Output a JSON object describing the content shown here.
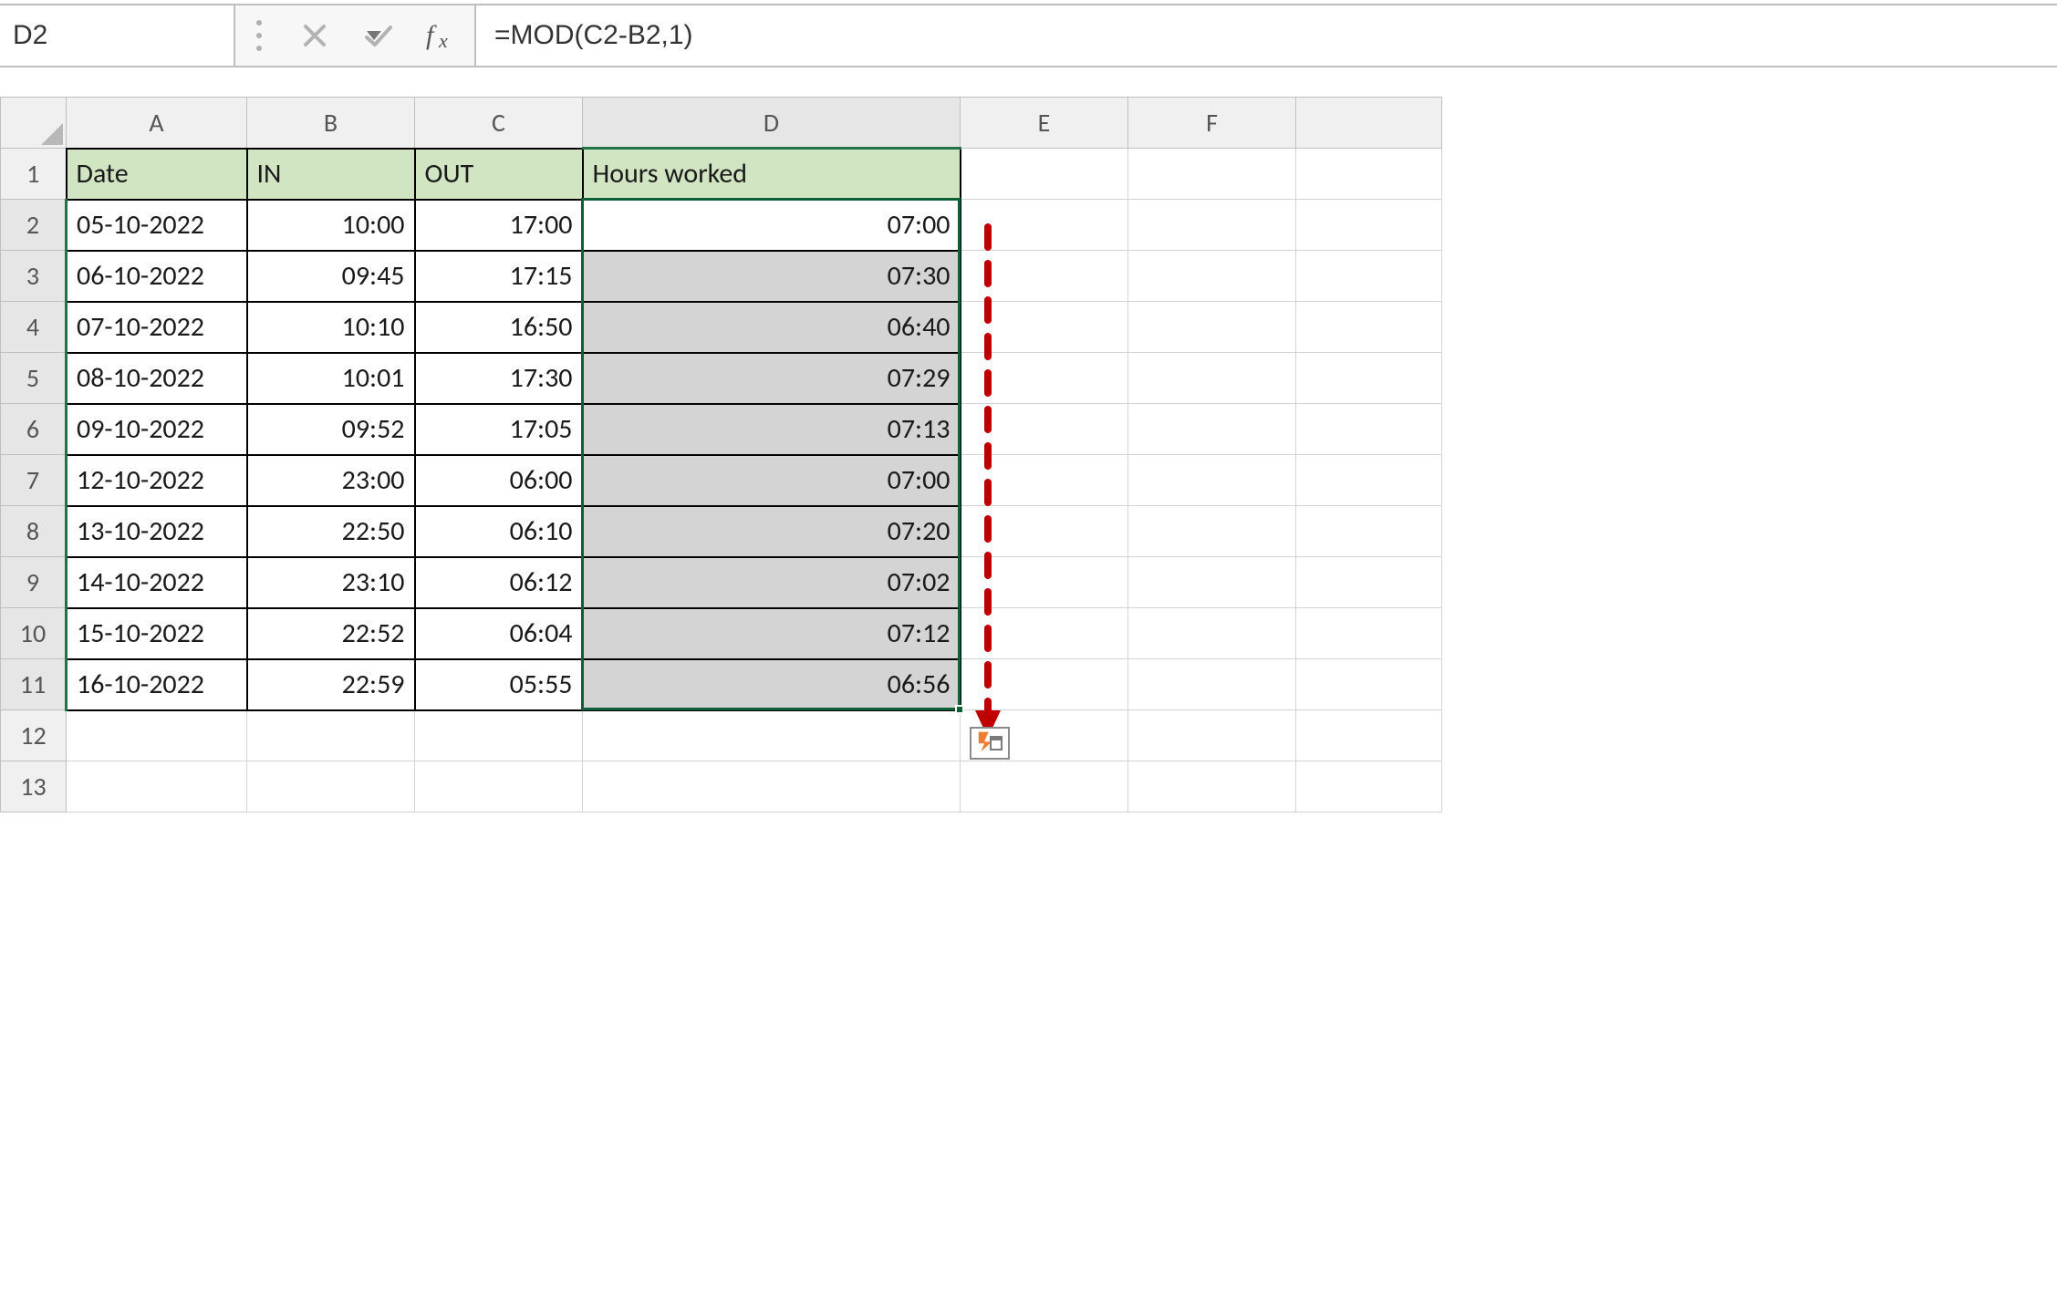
{
  "formula_bar": {
    "cell_ref": "D2",
    "formula": "=MOD(C2-B2,1)"
  },
  "columns": [
    "A",
    "B",
    "C",
    "D",
    "E",
    "F"
  ],
  "row_numbers": [
    "1",
    "2",
    "3",
    "4",
    "5",
    "6",
    "7",
    "8",
    "9",
    "10",
    "11",
    "12",
    "13"
  ],
  "headers": {
    "a": "Date",
    "b": "IN",
    "c": "OUT",
    "d": "Hours worked"
  },
  "rows": [
    {
      "date": "05-10-2022",
      "in": "10:00",
      "out": "17:00",
      "hours": "07:00"
    },
    {
      "date": "06-10-2022",
      "in": "09:45",
      "out": "17:15",
      "hours": "07:30"
    },
    {
      "date": "07-10-2022",
      "in": "10:10",
      "out": "16:50",
      "hours": "06:40"
    },
    {
      "date": "08-10-2022",
      "in": "10:01",
      "out": "17:30",
      "hours": "07:29"
    },
    {
      "date": "09-10-2022",
      "in": "09:52",
      "out": "17:05",
      "hours": "07:13"
    },
    {
      "date": "12-10-2022",
      "in": "23:00",
      "out": "06:00",
      "hours": "07:00"
    },
    {
      "date": "13-10-2022",
      "in": "22:50",
      "out": "06:10",
      "hours": "07:20"
    },
    {
      "date": "14-10-2022",
      "in": "23:10",
      "out": "06:12",
      "hours": "07:02"
    },
    {
      "date": "15-10-2022",
      "in": "22:52",
      "out": "06:04",
      "hours": "07:12"
    },
    {
      "date": "16-10-2022",
      "in": "22:59",
      "out": "05:55",
      "hours": "06:56"
    }
  ],
  "selection": {
    "active": "D2",
    "range": "D2:D11"
  }
}
